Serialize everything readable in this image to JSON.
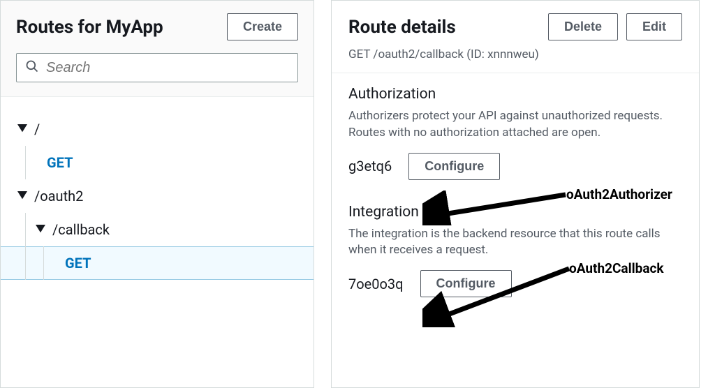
{
  "left": {
    "title": "Routes for MyApp",
    "create_label": "Create",
    "search_placeholder": "Search"
  },
  "tree": {
    "root": "/",
    "root_get": "GET",
    "oauth2": "/oauth2",
    "callback": "/callback",
    "callback_get": "GET"
  },
  "right": {
    "title": "Route details",
    "delete_label": "Delete",
    "edit_label": "Edit",
    "route_line": "GET /oauth2/callback (ID: xnnnweu)"
  },
  "auth": {
    "title": "Authorization",
    "desc": "Authorizers protect your API against unauthorized requests. Routes with no authorization attached are open.",
    "id": "g3etq6",
    "configure": "Configure",
    "annotation": "oAuth2Authorizer"
  },
  "integration": {
    "title": "Integration",
    "desc": "The integration is the backend resource that this route calls when it receives a request.",
    "id": "7oe0o3q",
    "configure": "Configure",
    "annotation": "oAuth2Callback"
  }
}
